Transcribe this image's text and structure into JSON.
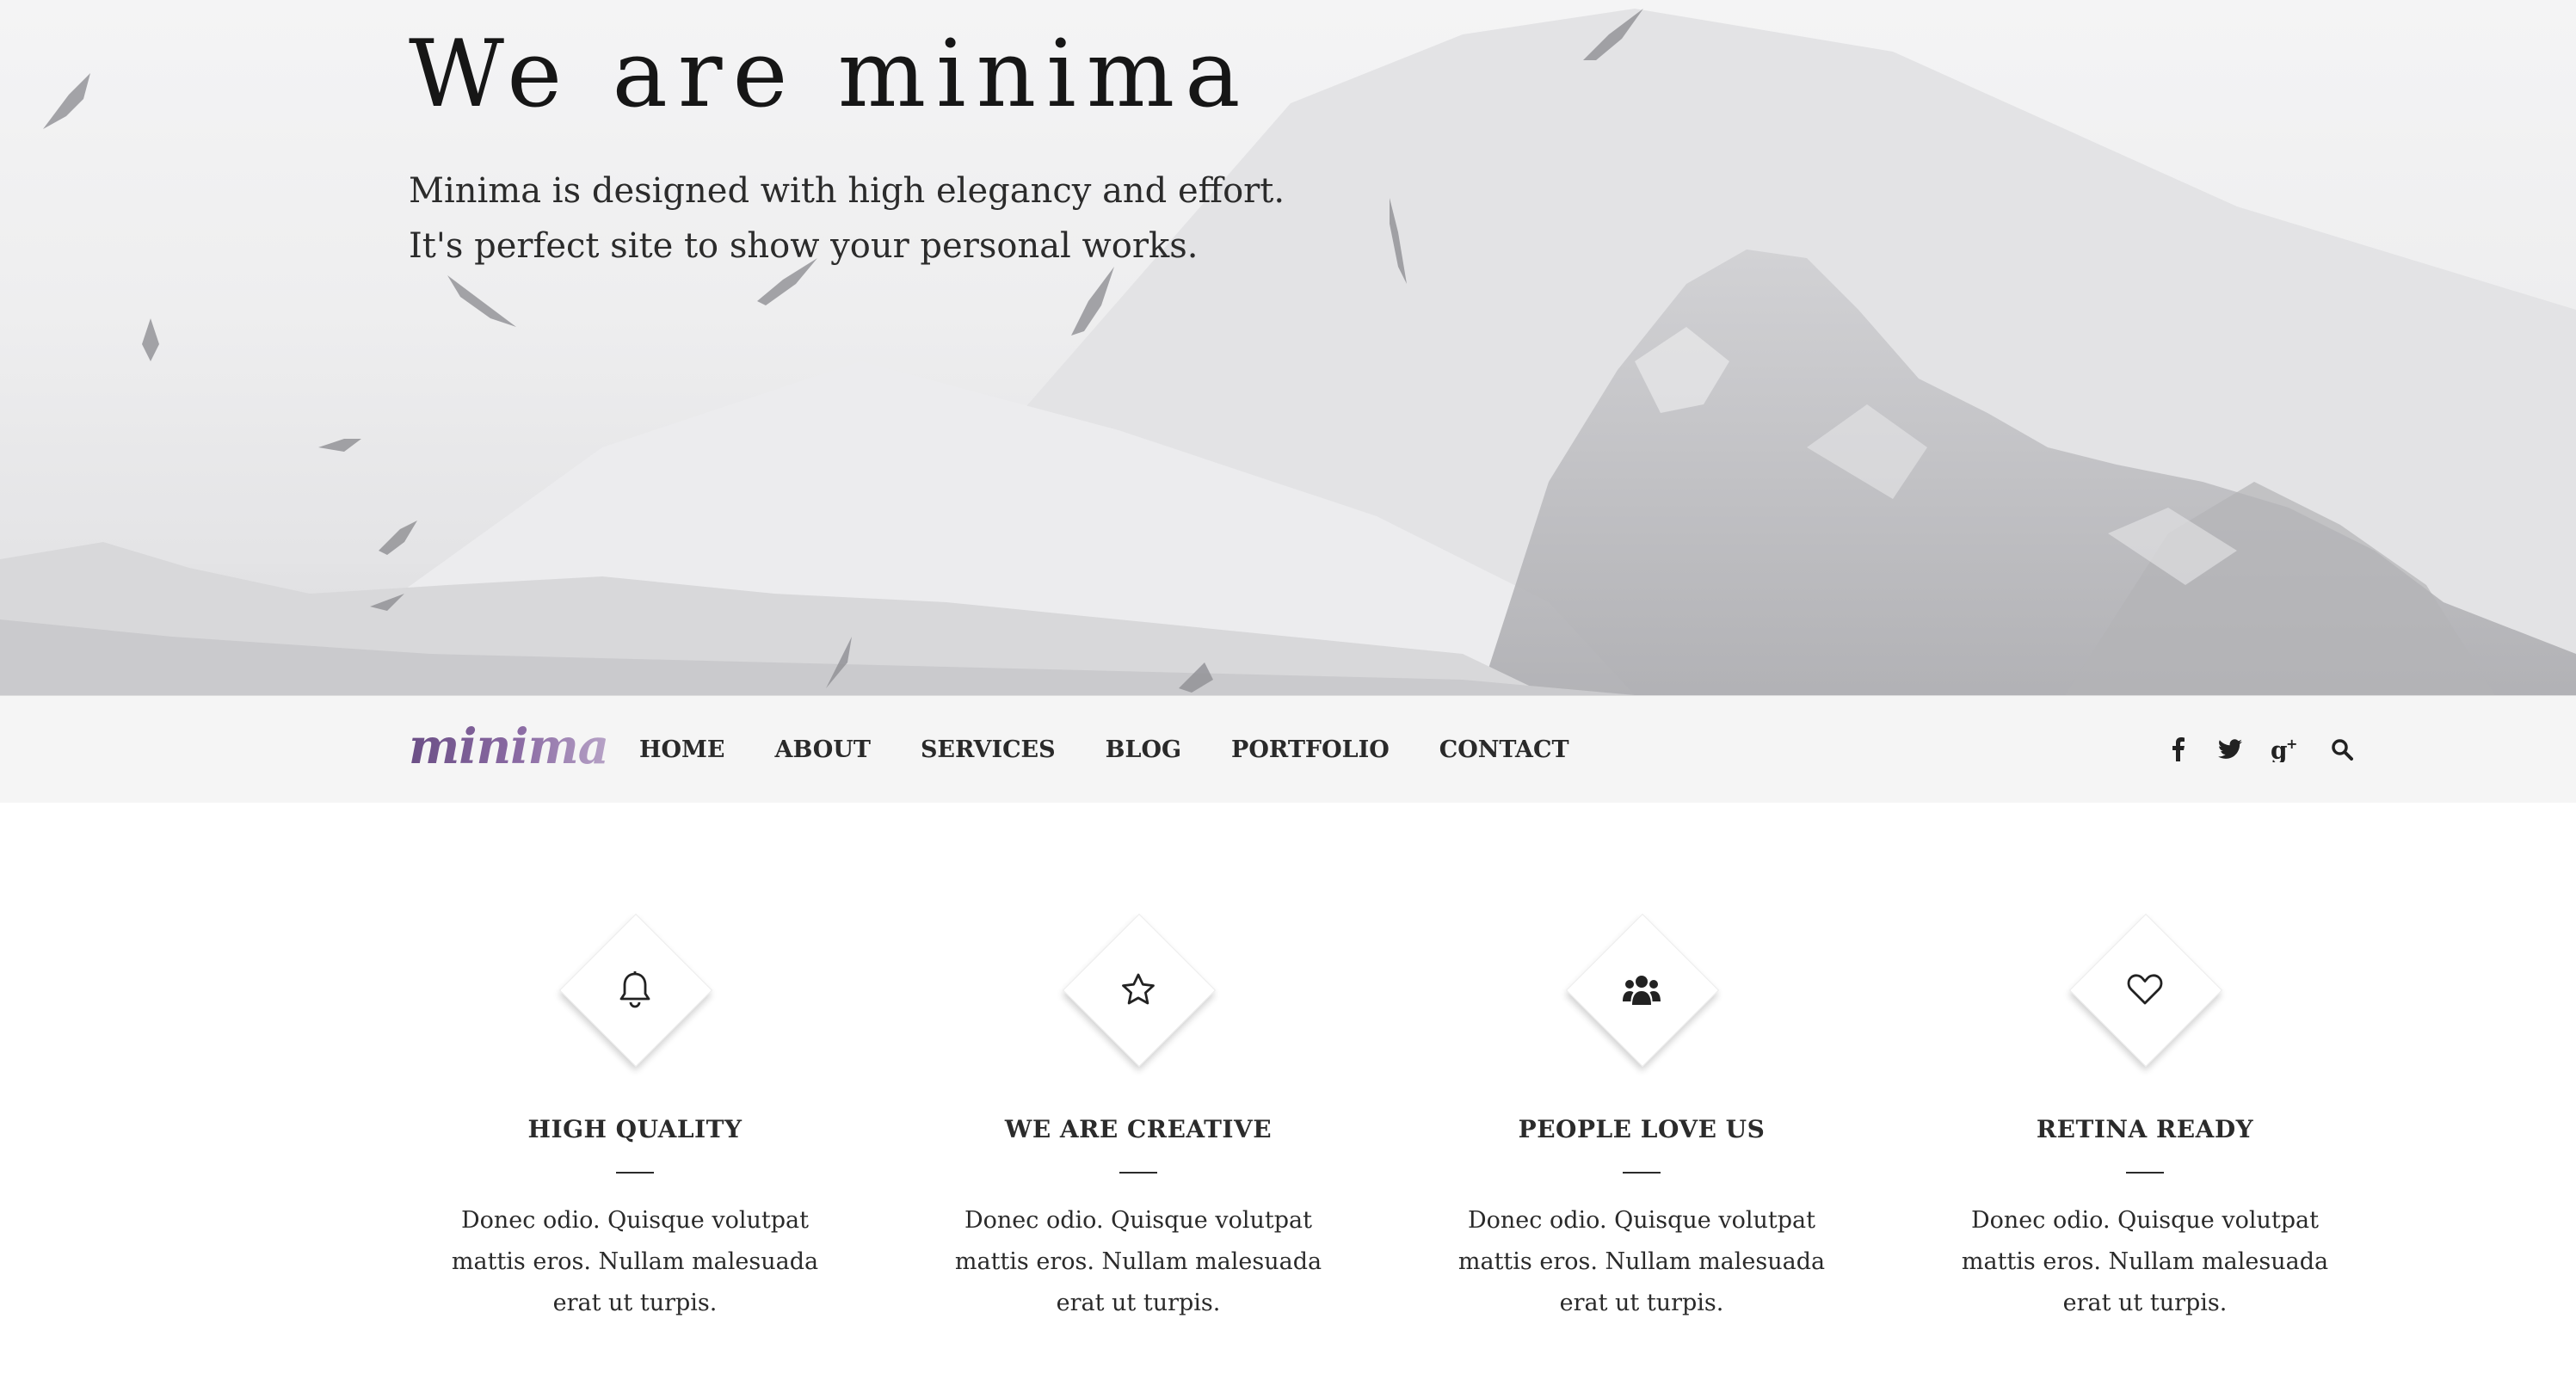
{
  "hero": {
    "title": "We are minima",
    "subtitle_lines": [
      "Minima is designed with high elegancy and effort.",
      "It's perfect site to show your personal works."
    ]
  },
  "nav": {
    "logo": "minima",
    "items": [
      "HOME",
      "ABOUT",
      "SERVICES",
      "BLOG",
      "PORTFOLIO",
      "CONTACT"
    ],
    "social_icons": [
      "facebook-icon",
      "twitter-icon",
      "google-plus-icon",
      "search-icon"
    ]
  },
  "features": [
    {
      "icon": "bell-icon",
      "title": "HIGH QUALITY",
      "text": "Donec odio. Quisque volutpat mattis eros. Nullam malesuada erat ut turpis."
    },
    {
      "icon": "star-icon",
      "title": "WE ARE CREATIVE",
      "text": "Donec odio. Quisque volutpat mattis eros. Nullam malesuada erat ut turpis."
    },
    {
      "icon": "users-icon",
      "title": "PEOPLE LOVE US",
      "text": "Donec odio. Quisque volutpat mattis eros. Nullam malesuada erat ut turpis."
    },
    {
      "icon": "heart-icon",
      "title": "RETINA READY",
      "text": "Donec odio. Quisque volutpat mattis eros. Nullam malesuada erat ut turpis."
    }
  ],
  "colors": {
    "nav_bg": "#f5f5f5",
    "logo": "#7a5c96",
    "text": "#2b2b2b"
  }
}
